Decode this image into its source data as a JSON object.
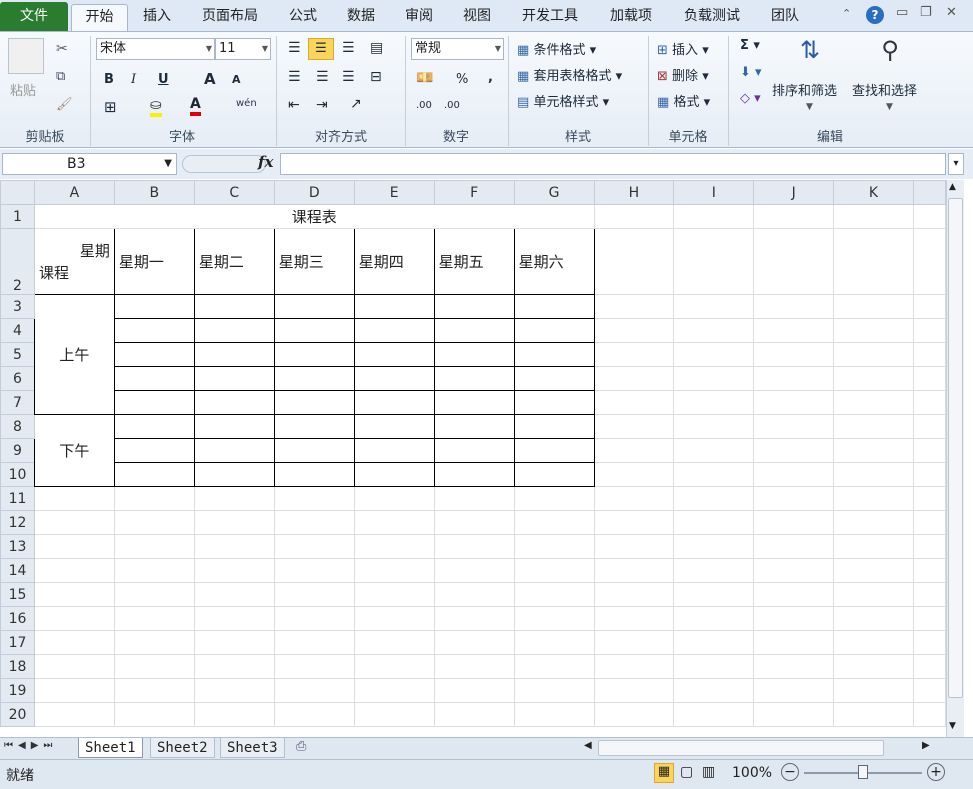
{
  "tabs": {
    "file": "文件",
    "home": "开始",
    "insert": "插入",
    "layout": "页面布局",
    "formula": "公式",
    "data": "数据",
    "review": "审阅",
    "view": "视图",
    "dev": "开发工具",
    "addins": "加载项",
    "loadtest": "负载测试",
    "team": "团队"
  },
  "ribbon": {
    "clipboard": {
      "paste": "粘贴",
      "group": "剪贴板"
    },
    "font": {
      "name": "宋体",
      "size": "11",
      "group": "字体",
      "bold": "B",
      "italic": "I",
      "underline": "U",
      "grow": "A",
      "shrink": "A",
      "color": "A",
      "wen": "wén"
    },
    "align": {
      "group": "对齐方式"
    },
    "number": {
      "format": "常规",
      "group": "数字",
      "percent": "%",
      "comma": ",",
      "inc": ".00",
      "dec": ".00"
    },
    "styles": {
      "cond": "条件格式",
      "table": "套用表格格式",
      "cell": "单元格样式",
      "group": "样式"
    },
    "cells": {
      "insert": "插入",
      "delete": "删除",
      "format": "格式",
      "group": "单元格"
    },
    "editing": {
      "sum": "Σ",
      "sort": "排序和筛选",
      "find": "查找和选择",
      "group": "编辑"
    }
  },
  "formula_bar": {
    "name_box": "B3",
    "fx": "fx",
    "value": ""
  },
  "columns": [
    "A",
    "B",
    "C",
    "D",
    "E",
    "F",
    "G",
    "H",
    "I",
    "J",
    "K"
  ],
  "rows": [
    "1",
    "2",
    "3",
    "4",
    "5",
    "6",
    "7",
    "8",
    "9",
    "10",
    "11",
    "12",
    "13",
    "14",
    "15",
    "16",
    "17",
    "18",
    "19",
    "20"
  ],
  "cells": {
    "title": "课程表",
    "header_week": "星期",
    "header_course": "课程",
    "days": [
      "星期一",
      "星期二",
      "星期三",
      "星期四",
      "星期五",
      "星期六"
    ],
    "morning": "上午",
    "afternoon": "下午"
  },
  "sheets": [
    "Sheet1",
    "Sheet2",
    "Sheet3"
  ],
  "status": {
    "ready": "就绪",
    "zoom": "100%"
  }
}
